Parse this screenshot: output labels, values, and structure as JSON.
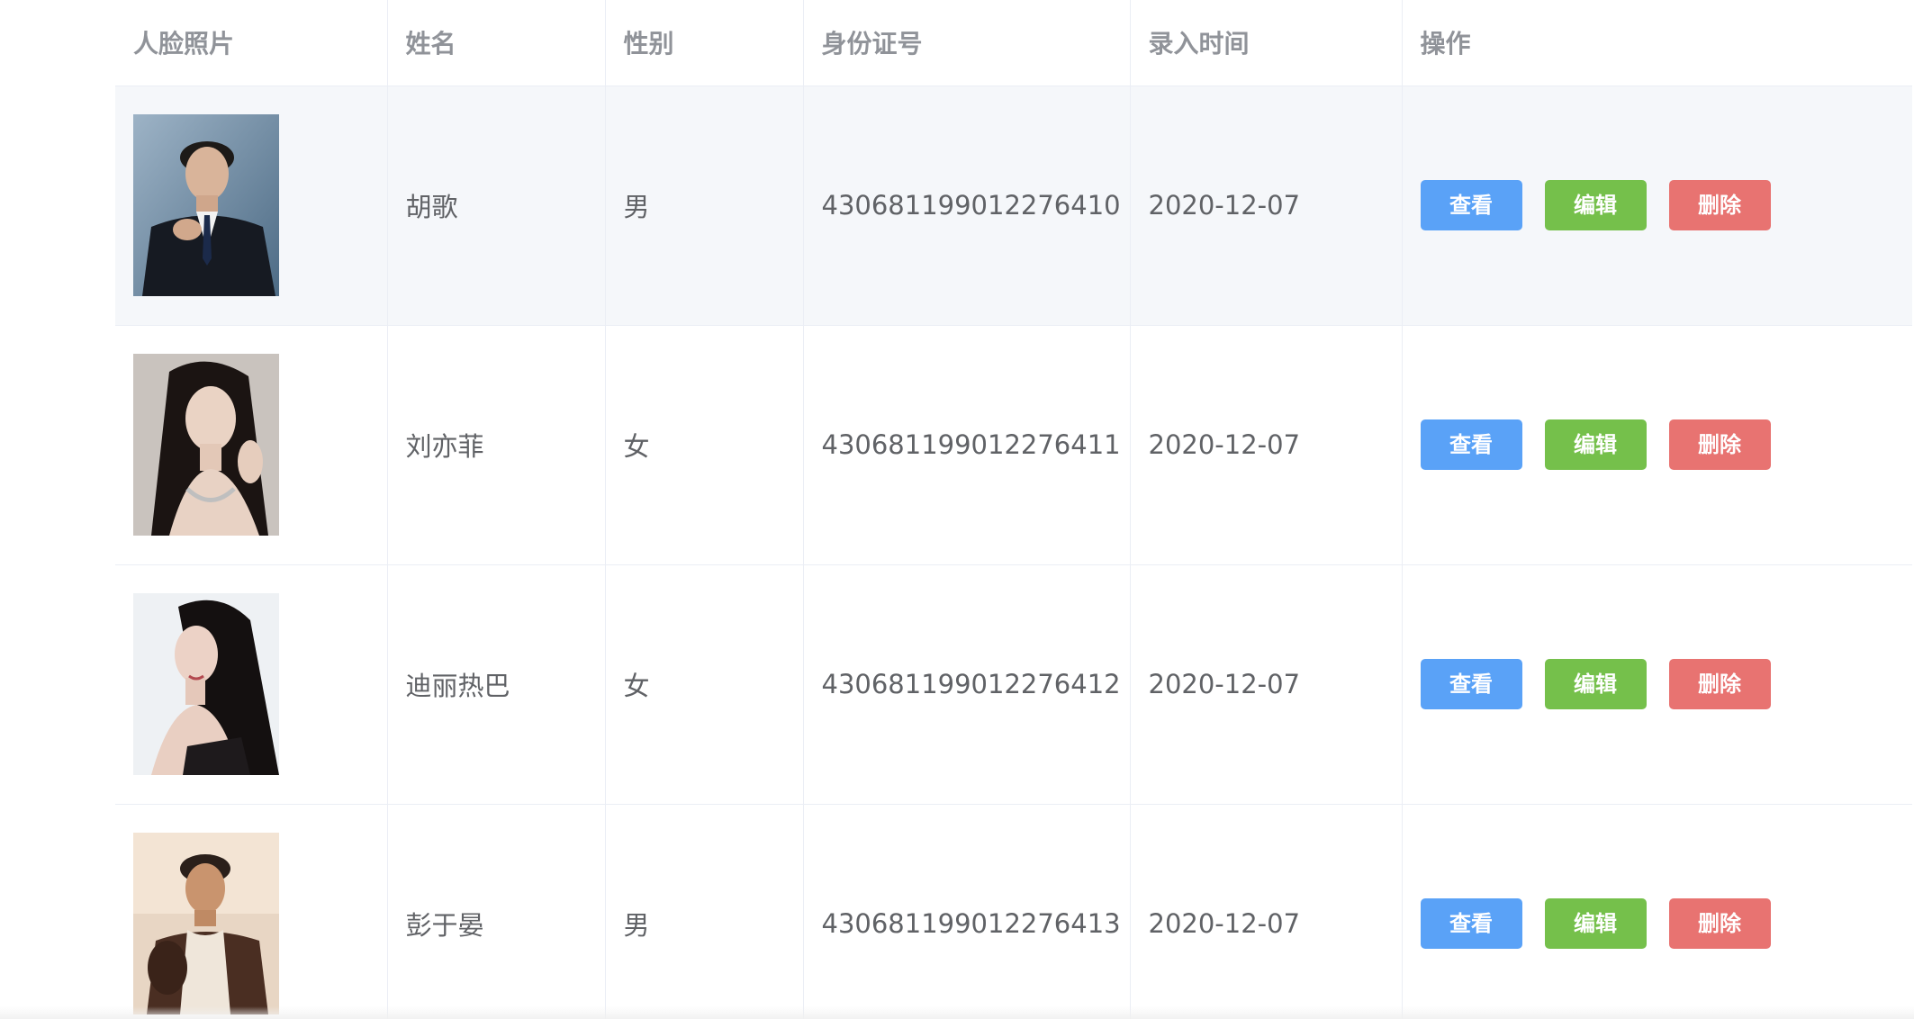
{
  "colors": {
    "header_text": "#909399",
    "body_text": "#606266",
    "border": "#ebeef5",
    "hover_row": "#f5f7fa",
    "view_button": "#5aa2f7",
    "edit_button": "#75c04b",
    "delete_button": "#e87371"
  },
  "table": {
    "columns": {
      "photo": "人脸照片",
      "name": "姓名",
      "gender": "性别",
      "id_number": "身份证号",
      "entry_time": "录入时间",
      "actions": "操作"
    },
    "action_labels": {
      "view": "查看",
      "edit": "编辑",
      "delete": "删除"
    },
    "rows": [
      {
        "photo_icon": "portrait-man-suit",
        "name": "胡歌",
        "gender": "男",
        "id_number": "430681199012276410",
        "entry_time": "2020-12-07"
      },
      {
        "photo_icon": "portrait-woman-long-hair",
        "name": "刘亦菲",
        "gender": "女",
        "id_number": "430681199012276411",
        "entry_time": "2020-12-07"
      },
      {
        "photo_icon": "portrait-woman-dark-hair",
        "name": "迪丽热巴",
        "gender": "女",
        "id_number": "430681199012276412",
        "entry_time": "2020-12-07"
      },
      {
        "photo_icon": "portrait-man-casual",
        "name": "彭于晏",
        "gender": "男",
        "id_number": "430681199012276413",
        "entry_time": "2020-12-07"
      }
    ]
  }
}
